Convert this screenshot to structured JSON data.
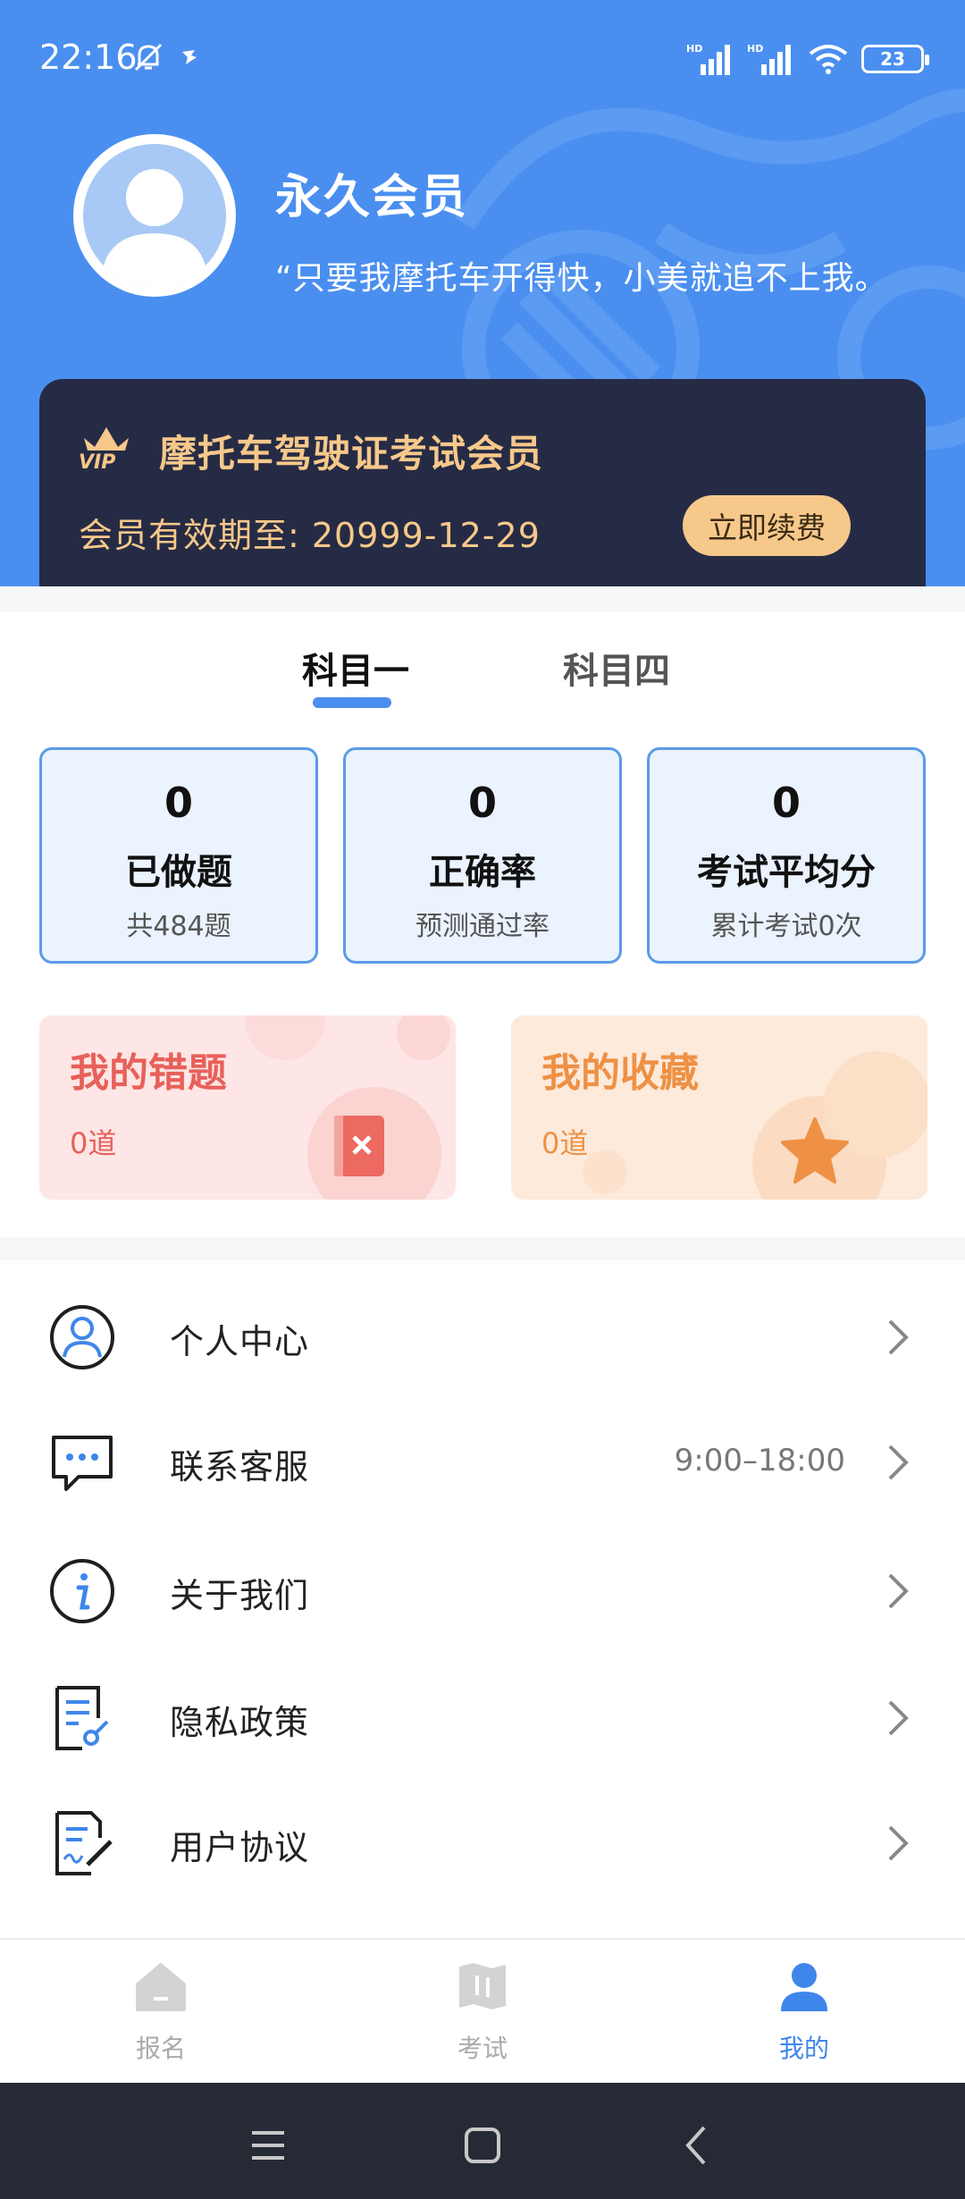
{
  "status_bar": {
    "time": "22:16",
    "signal_1": "HD",
    "signal_2": "HD",
    "battery": "23"
  },
  "profile": {
    "name": "永久会员",
    "motto": "“只要我摩托车开得快，小美就追不上我。"
  },
  "vip": {
    "badge": "VIP",
    "title": "摩托车驾驶证考试会员",
    "expiry": "会员有效期至: 20999-12-29",
    "renew_label": "立即续费"
  },
  "tabs": [
    {
      "label": "科目一",
      "active": true
    },
    {
      "label": "科目四",
      "active": false
    }
  ],
  "stats": [
    {
      "value": "0",
      "label": "已做题",
      "sub": "共484题"
    },
    {
      "value": "0",
      "label": "正确率",
      "sub": "预测通过率"
    },
    {
      "value": "0",
      "label": "考试平均分",
      "sub": "累计考试0次"
    }
  ],
  "features": [
    {
      "title": "我的错题",
      "count": "0道",
      "color": "#e8605a",
      "icon": "wrong-book-icon"
    },
    {
      "title": "我的收藏",
      "count": "0道",
      "color": "#ee9145",
      "icon": "star-icon"
    }
  ],
  "menu": [
    {
      "label": "个人中心",
      "extra": "",
      "icon": "user-circle-icon"
    },
    {
      "label": "联系客服",
      "extra": "9:00–18:00",
      "icon": "chat-bubble-icon"
    },
    {
      "label": "关于我们",
      "extra": "",
      "icon": "info-icon"
    },
    {
      "label": "隐私政策",
      "extra": "",
      "icon": "privacy-doc-icon"
    },
    {
      "label": "用户协议",
      "extra": "",
      "icon": "agreement-doc-icon"
    }
  ],
  "bottom_nav": [
    {
      "label": "报名",
      "icon": "home-icon",
      "active": false
    },
    {
      "label": "考试",
      "icon": "map-book-icon",
      "active": false
    },
    {
      "label": "我的",
      "icon": "person-icon",
      "active": true
    }
  ],
  "colors": {
    "primary": "#4a8ff0",
    "vip_bg": "#262b45",
    "vip_gold": "#f6c88a"
  }
}
